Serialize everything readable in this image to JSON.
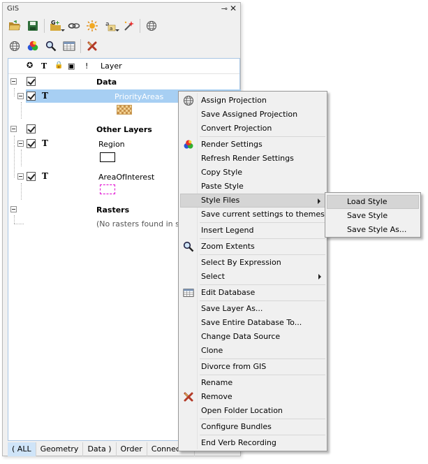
{
  "panel": {
    "title": "GIS",
    "pin_glyph": "⊸",
    "close_glyph": "✕"
  },
  "toolbar1": [
    {
      "name": "open-folder-icon"
    },
    {
      "name": "save-icon"
    },
    {
      "name": "add-layer-icon",
      "dropdown": true
    },
    {
      "name": "link-icon"
    },
    {
      "name": "sun-icon"
    },
    {
      "name": "text-label-icon",
      "dropdown": true
    },
    {
      "name": "magic-wand-icon"
    },
    {
      "name": "globe-icon"
    }
  ],
  "toolbar2": [
    {
      "name": "globe-icon"
    },
    {
      "name": "render-settings-icon"
    },
    {
      "name": "zoom-icon"
    },
    {
      "name": "table-icon"
    },
    {
      "name": "remove-icon"
    }
  ],
  "tree": {
    "headers": {
      "visible": "✪",
      "label": "T",
      "lock": "🔒",
      "info": "▣",
      "warn": "!",
      "layer": "Layer"
    },
    "groups": [
      {
        "name": "Data",
        "layers": [
          {
            "name": "PriorityAreas",
            "symbol": "checker",
            "selected": true
          }
        ]
      },
      {
        "name": "Other Layers",
        "layers": [
          {
            "name": "Region",
            "symbol": "rect"
          },
          {
            "name": "AreaOfInterest",
            "symbol": "dashed"
          }
        ]
      },
      {
        "name": "Rasters",
        "empty_text": "(No rasters found in sear"
      }
    ],
    "t_glyph": "T"
  },
  "tabs": [
    "( ALL",
    "Geometry",
    "Data )",
    "Order",
    "Connectio"
  ],
  "menu": {
    "items": [
      {
        "label": "Assign Projection",
        "icon": "globe-icon"
      },
      {
        "label": "Save Assigned Projection"
      },
      {
        "label": "Convert Projection"
      },
      {
        "label": "Render Settings",
        "icon": "render-settings-icon"
      },
      {
        "label": "Refresh Render Settings"
      },
      {
        "label": "Copy Style"
      },
      {
        "label": "Paste Style"
      },
      {
        "label": "Style Files",
        "submenu": true,
        "highlighted": true
      },
      {
        "label": "Save current settings to themes"
      },
      {
        "label": "Insert Legend"
      },
      {
        "label": "Zoom Extents",
        "icon": "zoom-icon"
      },
      {
        "label": "Select By Expression"
      },
      {
        "label": "Select",
        "submenu": true
      },
      {
        "label": "Edit Database",
        "icon": "table-icon"
      },
      {
        "label": "Save Layer As..."
      },
      {
        "label": "Save Entire Database To..."
      },
      {
        "label": "Change Data Source"
      },
      {
        "label": "Clone"
      },
      {
        "label": "Divorce from GIS"
      },
      {
        "label": "Rename"
      },
      {
        "label": "Remove",
        "icon": "remove-icon"
      },
      {
        "label": "Open Folder Location"
      },
      {
        "label": "Configure Bundles"
      },
      {
        "label": "End Verb Recording"
      }
    ]
  },
  "submenu": {
    "items": [
      "Load Style",
      "Save Style",
      "Save Style As..."
    ],
    "highlighted": "Load Style"
  }
}
